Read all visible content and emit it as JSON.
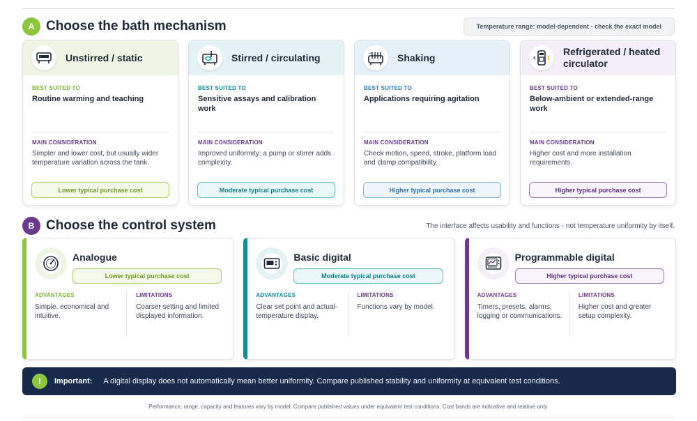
{
  "section_a": {
    "badge": "A",
    "title": "Choose the bath mechanism",
    "note": "Temperature range: model-dependent - check the exact model"
  },
  "labels": {
    "best_suited": "BEST SUITED TO",
    "main_consideration": "MAIN CONSIDERATION",
    "advantages": "ADVANTAGES",
    "limitations": "LIMITATIONS"
  },
  "mechanisms": [
    {
      "title": "Unstirred / static",
      "icon": "static-bath-icon",
      "best": "Routine warming and teaching",
      "consideration": "Simpler and lower cost, but usually wider temperature variation across the tank.",
      "cost": "Lower typical purchase cost",
      "head_bg": "#eef6e3",
      "accent": "#7ab531",
      "pill_bg": "#f4f9ea",
      "pill_border": "#a9d16e",
      "pill_text": "#6a9c26"
    },
    {
      "title": "Stirred / circulating",
      "icon": "circulating-bath-icon",
      "best": "Sensitive assays and calibration work",
      "consideration": "Improved uniformity; a pump or stirrer adds complexity.",
      "cost": "Moderate typical purchase cost",
      "head_bg": "#e3f3f5",
      "accent": "#0d8f9c",
      "pill_bg": "#eaf7f8",
      "pill_border": "#5fb9c2",
      "pill_text": "#0d7f8b"
    },
    {
      "title": "Shaking",
      "icon": "shaking-bath-icon",
      "best": "Applications requiring agitation",
      "consideration": "Check motion, speed, stroke, platform load and clamp compatibility.",
      "cost": "Higher typical purchase cost",
      "head_bg": "#e6f0f9",
      "accent": "#2c7fc1",
      "pill_bg": "#eef5fc",
      "pill_border": "#7fb1dc",
      "pill_text": "#2c6fa8"
    },
    {
      "title": "Refrigerated / heated circulator",
      "icon": "circulator-icon",
      "best": "Below-ambient or extended-range work",
      "consideration": "Higher cost and more installation requirements.",
      "cost": "Higher typical purchase cost",
      "head_bg": "#f3eef7",
      "accent": "#6b3a8c",
      "pill_bg": "#f8f4fb",
      "pill_border": "#9a74b5",
      "pill_text": "#5e2f80"
    }
  ],
  "section_b": {
    "badge": "B",
    "title": "Choose the control system",
    "note": "The interface affects usability and functions - not temperature uniformity by itself."
  },
  "controls": [
    {
      "title": "Analogue",
      "icon": "dial-gauge-icon",
      "cost": "Lower typical purchase cost",
      "advantages": "Simple, economical and intuitive.",
      "limitations": "Coarser setting and limited displayed information.",
      "accent": "#8cc63f",
      "icon_bg": "#eef6e3",
      "pill_bg": "#f4f9ea",
      "pill_border": "#a9d16e",
      "pill_text": "#6a9c26"
    },
    {
      "title": "Basic digital",
      "icon": "digital-display-icon",
      "cost": "Moderate typical purchase cost",
      "advantages": "Clear set point and actual-temperature display.",
      "limitations": "Functions vary by model.",
      "accent": "#0d8f9c",
      "icon_bg": "#e3f3f5",
      "pill_bg": "#eaf7f8",
      "pill_border": "#5fb9c2",
      "pill_text": "#0d7f8b"
    },
    {
      "title": "Programmable digital",
      "icon": "programmable-display-icon",
      "cost": "Higher typical purchase cost",
      "advantages": "Timers, presets, alarms, logging or communications.",
      "limitations": "Higher cost and greater setup complexity.",
      "accent": "#6b3a8c",
      "icon_bg": "#f3eef7",
      "pill_bg": "#f8f4fb",
      "pill_border": "#9a74b5",
      "pill_text": "#5e2f80"
    }
  ],
  "important": {
    "icon": "!",
    "label": "Important:",
    "text": "A digital display does not automatically mean better uniformity. Compare published stability and uniformity at equivalent test conditions."
  },
  "footnote": "Performance, range, capacity and features vary by model. Compare published values under equivalent test conditions. Cost bands are indicative and relative only.",
  "colors": {
    "badge_a": "#8cc63f",
    "badge_b": "#6b3a8c",
    "banner": "#172a4a"
  }
}
